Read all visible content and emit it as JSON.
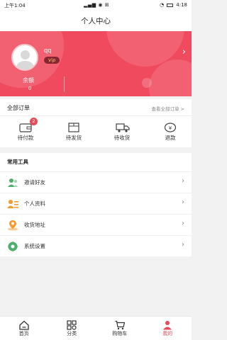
{
  "status_bar": {
    "time_left": "上午1:04",
    "time_right": "4:18"
  },
  "title": "个人中心",
  "profile": {
    "username": "qq",
    "vip": "Vip",
    "balance_label": "余额",
    "balance_value": "0"
  },
  "orders": {
    "title": "全部订单",
    "view_all": "查看全部订单 >",
    "items": [
      {
        "label": "待付款",
        "icon": "wallet-icon",
        "badge": "2"
      },
      {
        "label": "待发货",
        "icon": "box-icon"
      },
      {
        "label": "待收货",
        "icon": "truck-icon"
      },
      {
        "label": "退款",
        "icon": "refund-icon"
      }
    ]
  },
  "tools": {
    "title": "常用工具",
    "items": [
      {
        "label": "邀请好友",
        "icon": "invite-friends-icon"
      },
      {
        "label": "个人资料",
        "icon": "profile-card-icon"
      },
      {
        "label": "收货地址",
        "icon": "location-icon"
      },
      {
        "label": "系统设置",
        "icon": "settings-icon"
      }
    ]
  },
  "tabbar": [
    {
      "label": "首页",
      "icon": "home-icon"
    },
    {
      "label": "分类",
      "icon": "category-icon"
    },
    {
      "label": "购物车",
      "icon": "cart-icon"
    },
    {
      "label": "我的",
      "icon": "user-icon",
      "active": true
    }
  ],
  "colors": {
    "accent": "#ef4a5e",
    "green": "#4caf6e",
    "orange": "#f39a2b"
  }
}
